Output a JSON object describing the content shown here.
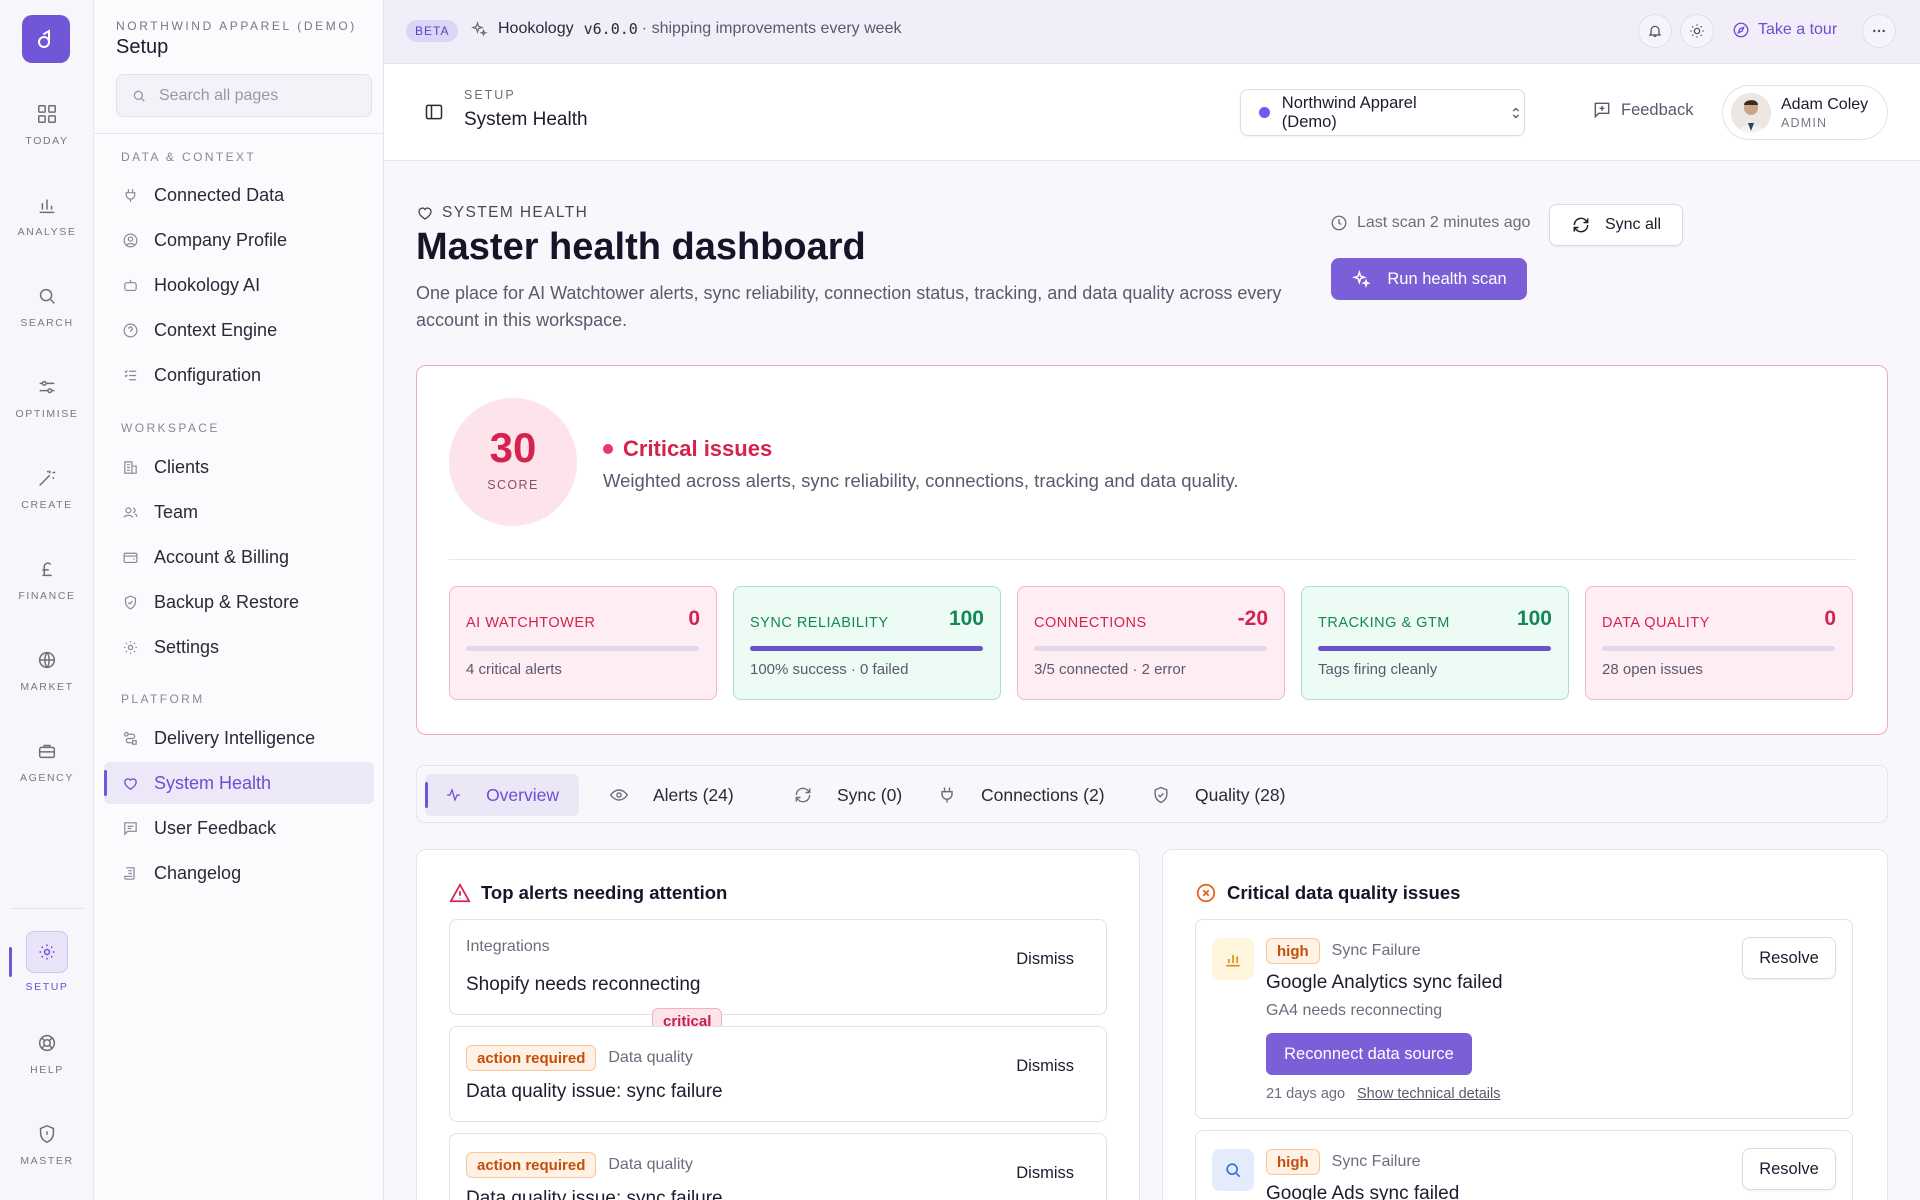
{
  "rail": {
    "items": [
      {
        "label": "TODAY",
        "icon": "grid-icon"
      },
      {
        "label": "ANALYSE",
        "icon": "bar-chart-icon"
      },
      {
        "label": "SEARCH",
        "icon": "search-icon"
      },
      {
        "label": "OPTIMISE",
        "icon": "sliders-icon"
      },
      {
        "label": "CREATE",
        "icon": "magic-wand-icon"
      },
      {
        "label": "FINANCE",
        "icon": "pound-icon"
      },
      {
        "label": "MARKET",
        "icon": "globe-icon"
      },
      {
        "label": "AGENCY",
        "icon": "briefcase-icon"
      }
    ],
    "bottom": [
      {
        "label": "SETUP",
        "icon": "gear-icon",
        "active": true
      },
      {
        "label": "HELP",
        "icon": "lifebuoy-icon"
      },
      {
        "label": "MASTER",
        "icon": "shield-icon"
      }
    ]
  },
  "sidebar": {
    "org": "NORTHWIND APPAREL (DEMO)",
    "title": "Setup",
    "search_placeholder": "Search all pages",
    "sections": [
      {
        "label": "DATA & CONTEXT",
        "items": [
          "Connected Data",
          "Company Profile",
          "Hookology AI",
          "Context Engine",
          "Configuration"
        ]
      },
      {
        "label": "WORKSPACE",
        "items": [
          "Clients",
          "Team",
          "Account & Billing",
          "Backup & Restore",
          "Settings"
        ]
      },
      {
        "label": "PLATFORM",
        "items": [
          "Delivery Intelligence",
          "System Health",
          "User Feedback",
          "Changelog"
        ]
      }
    ],
    "active_item": "System Health"
  },
  "topbar": {
    "beta": "BETA",
    "product": "Hookology",
    "version": "v6.0.0",
    "tagline": "· shipping improvements every week",
    "tour": "Take a tour"
  },
  "header": {
    "crumb_small": "SETUP",
    "crumb_title": "System Health",
    "org_select": "Northwind Apparel (Demo)",
    "feedback": "Feedback",
    "user_name": "Adam Coley",
    "user_role": "ADMIN"
  },
  "page": {
    "eyebrow": "SYSTEM HEALTH",
    "title": "Master health dashboard",
    "lead": "One place for AI Watchtower alerts, sync reliability, connection status, tracking, and data quality across every account in this workspace.",
    "last_scan": "Last scan 2 minutes ago",
    "sync_all": "Sync all",
    "run_scan": "Run health scan"
  },
  "health": {
    "score": "30",
    "score_label": "SCORE",
    "status": "Critical issues",
    "status_sub": "Weighted across alerts, sync reliability, connections, tracking and data quality.",
    "metrics": [
      {
        "title": "AI WATCHTOWER",
        "value": "0",
        "sub": "4 critical alerts",
        "tone": "red",
        "fill": 0
      },
      {
        "title": "SYNC RELIABILITY",
        "value": "100",
        "sub": "100% success · 0 failed",
        "tone": "green",
        "fill": 100
      },
      {
        "title": "CONNECTIONS",
        "value": "-20",
        "sub": "3/5 connected · 2 error",
        "tone": "red",
        "fill": 0
      },
      {
        "title": "TRACKING & GTM",
        "value": "100",
        "sub": "Tags firing cleanly",
        "tone": "green",
        "fill": 100
      },
      {
        "title": "DATA QUALITY",
        "value": "0",
        "sub": "28 open issues",
        "tone": "red",
        "fill": 0
      }
    ]
  },
  "tabs": [
    "Overview",
    "Alerts (24)",
    "Sync (0)",
    "Connections (2)",
    "Quality (28)"
  ],
  "alerts_panel": {
    "title": "Top alerts needing attention",
    "dismiss": "Dismiss",
    "items": [
      {
        "badge": "critical",
        "category": "Integrations",
        "title": "Shopify needs reconnecting"
      },
      {
        "badge": "action required",
        "category": "Data quality",
        "title": "Data quality issue: sync failure"
      },
      {
        "badge": "action required",
        "category": "Data quality",
        "title": "Data quality issue: sync failure"
      }
    ]
  },
  "quality_panel": {
    "title": "Critical data quality issues",
    "resolve": "Resolve",
    "items": [
      {
        "badge": "high",
        "category": "Sync Failure",
        "title": "Google Analytics sync failed",
        "sub": "GA4 needs reconnecting",
        "action": "Reconnect data source",
        "age": "21 days ago",
        "details": "Show technical details"
      },
      {
        "badge": "high",
        "category": "Sync Failure",
        "title": "Google Ads sync failed"
      }
    ]
  },
  "colors": {
    "accent": "#7256d8",
    "critical": "#d4234f",
    "success": "#15865a"
  }
}
